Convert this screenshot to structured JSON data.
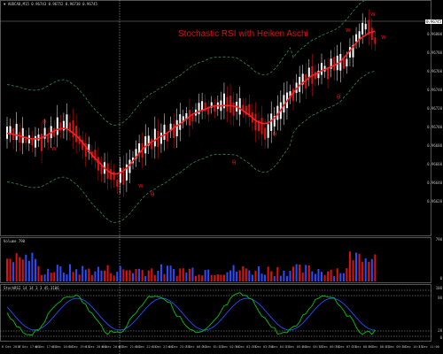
{
  "main": {
    "symbol_header": "▼ AUDCAD,M15  0.96743 0.96752 0.96738 0.96745",
    "title": "Stochastic RSI with Heiken Aschi",
    "price_labels": [
      "0.96800",
      "0.96780",
      "0.96760",
      "0.96740",
      "0.96720",
      "0.96700",
      "0.96680",
      "0.96660",
      "0.96640",
      "0.96620"
    ],
    "current_price": "0.96745",
    "arrow_labels": [
      {
        "text": "w",
        "color": "#e01010"
      },
      {
        "text": "w",
        "color": "#e01010"
      },
      {
        "text": "θ",
        "color": "#e01010"
      },
      {
        "text": "θ",
        "color": "#e01010"
      },
      {
        "text": "w",
        "color": "#e01010"
      },
      {
        "text": "θ",
        "color": "#e01010"
      },
      {
        "text": "θ",
        "color": "#e01010"
      },
      {
        "text": "w",
        "color": "#e01010"
      },
      {
        "text": "θ",
        "color": "#e01010"
      },
      {
        "text": "w",
        "color": "#e01010"
      },
      {
        "text": "w",
        "color": "#e01010"
      }
    ]
  },
  "volume": {
    "header": "Volume  790",
    "scale_top": "790",
    "scale_bottom": "0"
  },
  "stochrsi": {
    "header": "StochRSI  14 14 3 3  45.3106",
    "levels": [
      "100",
      "80",
      "20",
      "0"
    ]
  },
  "time_axis": {
    "labels": [
      "6 Dec 2017",
      "6 Dec 17:00",
      "6 Dec 17:45",
      "6 Dec 18:30",
      "6 Dec 19:15",
      "6 Dec 20:00",
      "6 Dec 20:45",
      "6 Dec 21:30",
      "6 Dec 22:15",
      "6 Dec 23:00",
      "6 Dec 23:45",
      "7 Dec 00:30",
      "7 Dec 01:15",
      "7 Dec 02:00",
      "7 Dec 02:45",
      "7 Dec 03:30",
      "7 Dec 04:15",
      "7 Dec 05:00",
      "7 Dec 05:45",
      "7 Dec 06:30",
      "7 Dec 07:15",
      "7 Dec 08:00",
      "7 Dec 08:45",
      "7 Dec 09:30",
      "7 Dec 10:15",
      "7 Dec 11:00"
    ]
  },
  "colors": {
    "bull": "#ffffff",
    "bear": "#e01010",
    "band": "#2e8b57",
    "ha_line": "#ff2020",
    "vol_up": "#2a4cff",
    "vol_down": "#e01010",
    "stoch_k": "#00c800",
    "stoch_d": "#2a4cff"
  }
}
